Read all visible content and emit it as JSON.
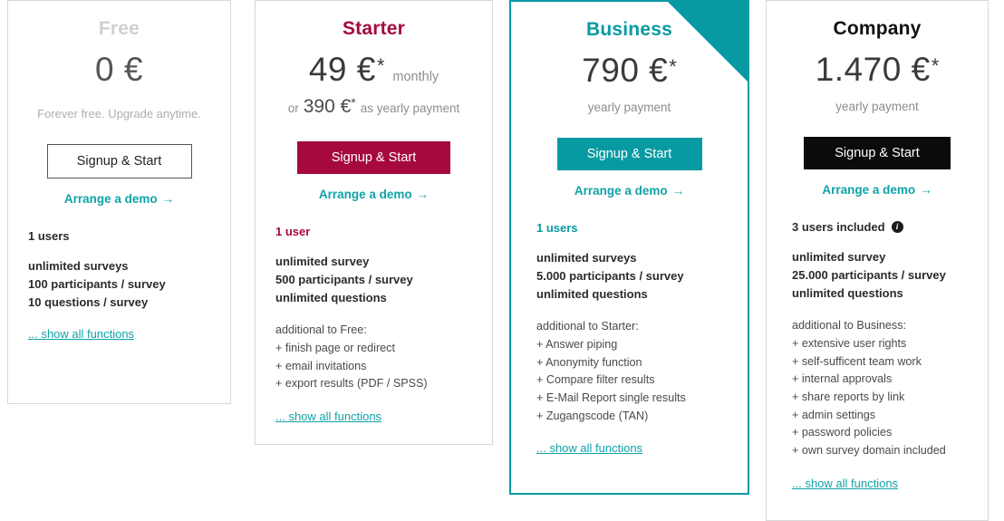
{
  "accent_colors": {
    "teal": "#089aa2",
    "crimson": "#a6093d",
    "black": "#0b0b0b",
    "muted_grey": "#cfcfcf",
    "link_teal": "#0fa3a8"
  },
  "plans": [
    {
      "id": "free",
      "name": "Free",
      "price_main": "0 €",
      "price_star": "",
      "price_suffix": "",
      "secondary": null,
      "pay_note": "",
      "free_note": "Forever free. Upgrade anytime.",
      "cta_label": "Signup & Start",
      "demo_label": "Arrange a demo",
      "demo_arrow": "→",
      "users_line": "1 users",
      "has_info_icon": false,
      "info_icon_glyph": "i",
      "features_bold": [
        "unlimited surveys",
        "100 participants / survey",
        "10 questions / survey"
      ],
      "extra_heading": "",
      "features_extra": [],
      "show_all_label": "... show all functions"
    },
    {
      "id": "starter",
      "name": "Starter",
      "price_main": "49 €",
      "price_star": "*",
      "price_suffix": "monthly",
      "secondary": {
        "pre": "or",
        "amount": "390 €",
        "star": "*",
        "post": "as yearly payment"
      },
      "pay_note": "",
      "free_note": "",
      "cta_label": "Signup & Start",
      "demo_label": "Arrange a demo",
      "demo_arrow": "→",
      "users_line": "1 user",
      "has_info_icon": false,
      "info_icon_glyph": "i",
      "features_bold": [
        "unlimited survey",
        "500 participants / survey",
        "unlimited questions"
      ],
      "extra_heading": "additional to Free:",
      "features_extra": [
        "+ finish page or redirect",
        "+ email invitations",
        "+ export results (PDF / SPSS)"
      ],
      "show_all_label": "... show all functions"
    },
    {
      "id": "business",
      "name": "Business",
      "price_main": "790 €",
      "price_star": "*",
      "price_suffix": "",
      "secondary": null,
      "pay_note": "yearly payment",
      "free_note": "",
      "cta_label": "Signup & Start",
      "demo_label": "Arrange a demo",
      "demo_arrow": "→",
      "users_line": "1 users",
      "has_info_icon": false,
      "info_icon_glyph": "i",
      "features_bold": [
        "unlimited surveys",
        "5.000 participants / survey",
        "unlimited questions"
      ],
      "extra_heading": "additional to Starter:",
      "features_extra": [
        "+ Answer piping",
        "+ Anonymity function",
        "+ Compare filter results",
        "+ E-Mail Report single results",
        "+ Zugangscode (TAN)"
      ],
      "show_all_label": "... show all functions"
    },
    {
      "id": "company",
      "name": "Company",
      "price_main": "1.470 €",
      "price_star": "*",
      "price_suffix": "",
      "secondary": null,
      "pay_note": "yearly payment",
      "free_note": "",
      "cta_label": "Signup & Start",
      "demo_label": "Arrange a demo",
      "demo_arrow": "→",
      "users_line": "3 users included",
      "has_info_icon": true,
      "info_icon_glyph": "i",
      "features_bold": [
        "unlimited survey",
        "25.000 participants / survey",
        "unlimited questions"
      ],
      "extra_heading": "additional to Business:",
      "features_extra": [
        "+ extensive user rights",
        "+ self-sufficent team work",
        "+ internal approvals",
        "+ share reports by link",
        "+ admin settings",
        "+ password policies",
        "+ own survey domain included"
      ],
      "show_all_label": "... show all functions"
    }
  ]
}
